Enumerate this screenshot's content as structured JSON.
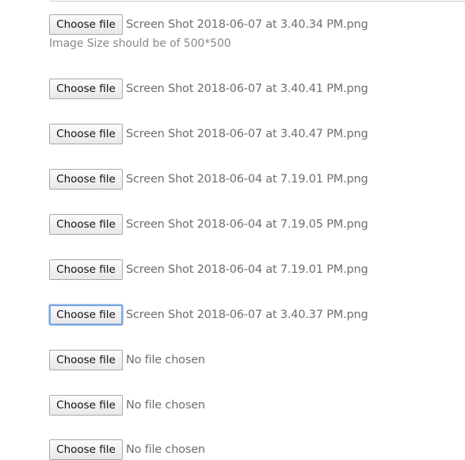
{
  "uploads": [
    {
      "button_label": "Choose file",
      "file_name": "Screen Shot 2018-06-07 at 3.40.34 PM.png",
      "focused": false
    },
    {
      "button_label": "Choose file",
      "file_name": "Screen Shot 2018-06-07 at 3.40.41 PM.png",
      "focused": false
    },
    {
      "button_label": "Choose file",
      "file_name": "Screen Shot 2018-06-07 at 3.40.47 PM.png",
      "focused": false
    },
    {
      "button_label": "Choose file",
      "file_name": "Screen Shot 2018-06-04 at 7.19.01 PM.png",
      "focused": false
    },
    {
      "button_label": "Choose file",
      "file_name": "Screen Shot 2018-06-04 at 7.19.05 PM.png",
      "focused": false
    },
    {
      "button_label": "Choose file",
      "file_name": "Screen Shot 2018-06-04 at 7.19.01 PM.png",
      "focused": false
    },
    {
      "button_label": "Choose file",
      "file_name": "Screen Shot 2018-06-07 at 3.40.37 PM.png",
      "focused": true
    },
    {
      "button_label": "Choose file",
      "file_name": "No file chosen",
      "focused": false
    },
    {
      "button_label": "Choose file",
      "file_name": "No file chosen",
      "focused": false
    },
    {
      "button_label": "Choose file",
      "file_name": "No file chosen",
      "focused": false
    }
  ],
  "hint": {
    "text": "Image Size should be of 500*500"
  },
  "colors": {
    "focus_ring": "#7aa7e0",
    "text_muted": "#6e6e6e"
  }
}
